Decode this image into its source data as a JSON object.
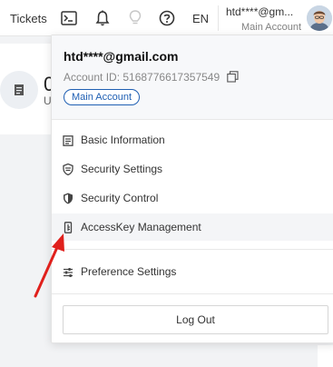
{
  "topbar": {
    "tickets_label": "Tickets",
    "lang_label": "EN",
    "user_name": "htd****@gm...",
    "user_role": "Main Account",
    "icons": [
      "terminal-icon",
      "bell-icon",
      "lightbulb-icon",
      "help-icon"
    ]
  },
  "background": {
    "stat_value": "0",
    "stat_caption": "U"
  },
  "dropdown": {
    "email": "htd****@gmail.com",
    "account_id": "Account ID: 5168776617357549",
    "badge": "Main Account",
    "items": [
      {
        "label": "Basic Information",
        "icon": "document-icon"
      },
      {
        "label": "Security Settings",
        "icon": "shield-lock-icon"
      },
      {
        "label": "Security Control",
        "icon": "shield-icon"
      },
      {
        "label": "AccessKey Management",
        "icon": "key-icon"
      },
      {
        "label": "Preference Settings",
        "icon": "sliders-icon"
      }
    ],
    "logout_label": "Log Out"
  },
  "colors": {
    "accent": "#1f5fb3",
    "annotation_arrow": "#e0201c"
  }
}
